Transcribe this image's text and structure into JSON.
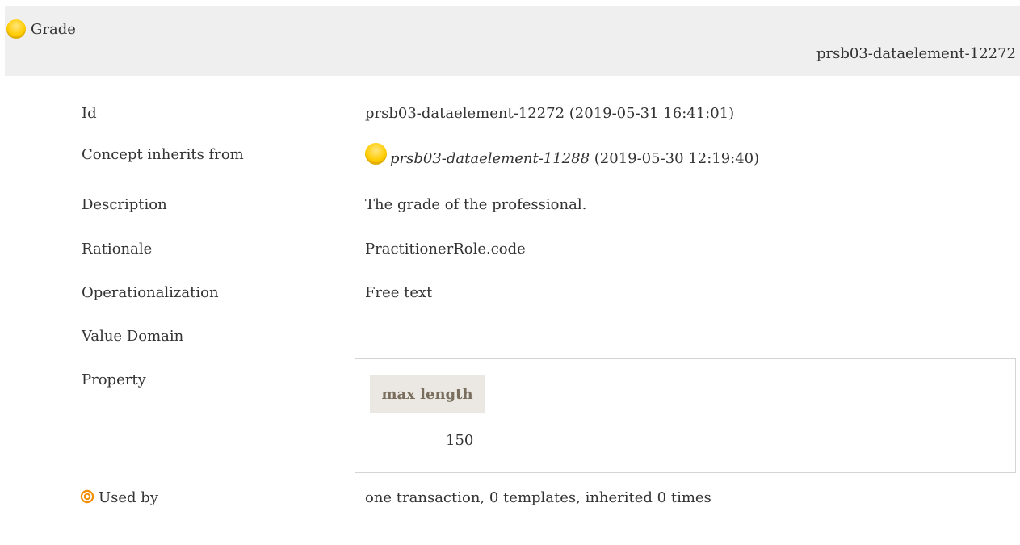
{
  "header": {
    "title": "Grade",
    "id": "prsb03-dataelement-12272"
  },
  "rows": {
    "id": {
      "label": "Id",
      "value": "prsb03-dataelement-12272 (2019-05-31 16:41:01)"
    },
    "inherits": {
      "label": "Concept inherits from",
      "link": "prsb03-dataelement-11288",
      "suffix": " (2019-05-30 12:19:40)"
    },
    "description": {
      "label": "Description",
      "value": "The grade of the professional."
    },
    "rationale": {
      "label": "Rationale",
      "value": "PractitionerRole.code"
    },
    "operationalization": {
      "label": "Operationalization",
      "value": "Free text"
    },
    "value_domain": {
      "label": "Value Domain"
    },
    "property": {
      "label": "Property",
      "header": "max length",
      "value": "150"
    },
    "used_by": {
      "label": "Used by",
      "value": "one transaction, 0 templates, inherited 0 times"
    }
  },
  "icons": {
    "title_icon": "concept-item-icon",
    "inherits_icon": "concept-item-icon",
    "used_by_icon": "target-icon"
  },
  "colors": {
    "header_bg": "#efefef",
    "concept_yellow": "#ffcc00",
    "property_header_bg": "#ebe8e3",
    "target_orange": "#f28c00"
  }
}
